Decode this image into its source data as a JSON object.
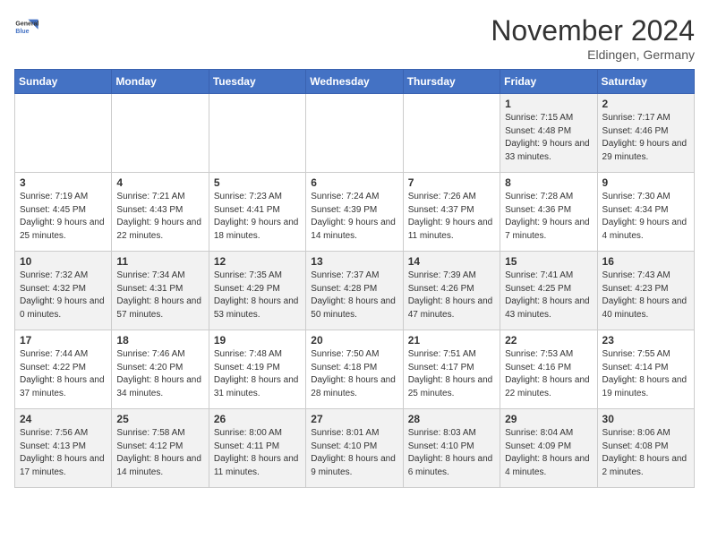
{
  "header": {
    "logo_general": "General",
    "logo_blue": "Blue",
    "month_title": "November 2024",
    "location": "Eldingen, Germany"
  },
  "weekdays": [
    "Sunday",
    "Monday",
    "Tuesday",
    "Wednesday",
    "Thursday",
    "Friday",
    "Saturday"
  ],
  "weeks": [
    [
      {
        "day": "",
        "info": ""
      },
      {
        "day": "",
        "info": ""
      },
      {
        "day": "",
        "info": ""
      },
      {
        "day": "",
        "info": ""
      },
      {
        "day": "",
        "info": ""
      },
      {
        "day": "1",
        "info": "Sunrise: 7:15 AM\nSunset: 4:48 PM\nDaylight: 9 hours and 33 minutes."
      },
      {
        "day": "2",
        "info": "Sunrise: 7:17 AM\nSunset: 4:46 PM\nDaylight: 9 hours and 29 minutes."
      }
    ],
    [
      {
        "day": "3",
        "info": "Sunrise: 7:19 AM\nSunset: 4:45 PM\nDaylight: 9 hours and 25 minutes."
      },
      {
        "day": "4",
        "info": "Sunrise: 7:21 AM\nSunset: 4:43 PM\nDaylight: 9 hours and 22 minutes."
      },
      {
        "day": "5",
        "info": "Sunrise: 7:23 AM\nSunset: 4:41 PM\nDaylight: 9 hours and 18 minutes."
      },
      {
        "day": "6",
        "info": "Sunrise: 7:24 AM\nSunset: 4:39 PM\nDaylight: 9 hours and 14 minutes."
      },
      {
        "day": "7",
        "info": "Sunrise: 7:26 AM\nSunset: 4:37 PM\nDaylight: 9 hours and 11 minutes."
      },
      {
        "day": "8",
        "info": "Sunrise: 7:28 AM\nSunset: 4:36 PM\nDaylight: 9 hours and 7 minutes."
      },
      {
        "day": "9",
        "info": "Sunrise: 7:30 AM\nSunset: 4:34 PM\nDaylight: 9 hours and 4 minutes."
      }
    ],
    [
      {
        "day": "10",
        "info": "Sunrise: 7:32 AM\nSunset: 4:32 PM\nDaylight: 9 hours and 0 minutes."
      },
      {
        "day": "11",
        "info": "Sunrise: 7:34 AM\nSunset: 4:31 PM\nDaylight: 8 hours and 57 minutes."
      },
      {
        "day": "12",
        "info": "Sunrise: 7:35 AM\nSunset: 4:29 PM\nDaylight: 8 hours and 53 minutes."
      },
      {
        "day": "13",
        "info": "Sunrise: 7:37 AM\nSunset: 4:28 PM\nDaylight: 8 hours and 50 minutes."
      },
      {
        "day": "14",
        "info": "Sunrise: 7:39 AM\nSunset: 4:26 PM\nDaylight: 8 hours and 47 minutes."
      },
      {
        "day": "15",
        "info": "Sunrise: 7:41 AM\nSunset: 4:25 PM\nDaylight: 8 hours and 43 minutes."
      },
      {
        "day": "16",
        "info": "Sunrise: 7:43 AM\nSunset: 4:23 PM\nDaylight: 8 hours and 40 minutes."
      }
    ],
    [
      {
        "day": "17",
        "info": "Sunrise: 7:44 AM\nSunset: 4:22 PM\nDaylight: 8 hours and 37 minutes."
      },
      {
        "day": "18",
        "info": "Sunrise: 7:46 AM\nSunset: 4:20 PM\nDaylight: 8 hours and 34 minutes."
      },
      {
        "day": "19",
        "info": "Sunrise: 7:48 AM\nSunset: 4:19 PM\nDaylight: 8 hours and 31 minutes."
      },
      {
        "day": "20",
        "info": "Sunrise: 7:50 AM\nSunset: 4:18 PM\nDaylight: 8 hours and 28 minutes."
      },
      {
        "day": "21",
        "info": "Sunrise: 7:51 AM\nSunset: 4:17 PM\nDaylight: 8 hours and 25 minutes."
      },
      {
        "day": "22",
        "info": "Sunrise: 7:53 AM\nSunset: 4:16 PM\nDaylight: 8 hours and 22 minutes."
      },
      {
        "day": "23",
        "info": "Sunrise: 7:55 AM\nSunset: 4:14 PM\nDaylight: 8 hours and 19 minutes."
      }
    ],
    [
      {
        "day": "24",
        "info": "Sunrise: 7:56 AM\nSunset: 4:13 PM\nDaylight: 8 hours and 17 minutes."
      },
      {
        "day": "25",
        "info": "Sunrise: 7:58 AM\nSunset: 4:12 PM\nDaylight: 8 hours and 14 minutes."
      },
      {
        "day": "26",
        "info": "Sunrise: 8:00 AM\nSunset: 4:11 PM\nDaylight: 8 hours and 11 minutes."
      },
      {
        "day": "27",
        "info": "Sunrise: 8:01 AM\nSunset: 4:10 PM\nDaylight: 8 hours and 9 minutes."
      },
      {
        "day": "28",
        "info": "Sunrise: 8:03 AM\nSunset: 4:10 PM\nDaylight: 8 hours and 6 minutes."
      },
      {
        "day": "29",
        "info": "Sunrise: 8:04 AM\nSunset: 4:09 PM\nDaylight: 8 hours and 4 minutes."
      },
      {
        "day": "30",
        "info": "Sunrise: 8:06 AM\nSunset: 4:08 PM\nDaylight: 8 hours and 2 minutes."
      }
    ]
  ]
}
